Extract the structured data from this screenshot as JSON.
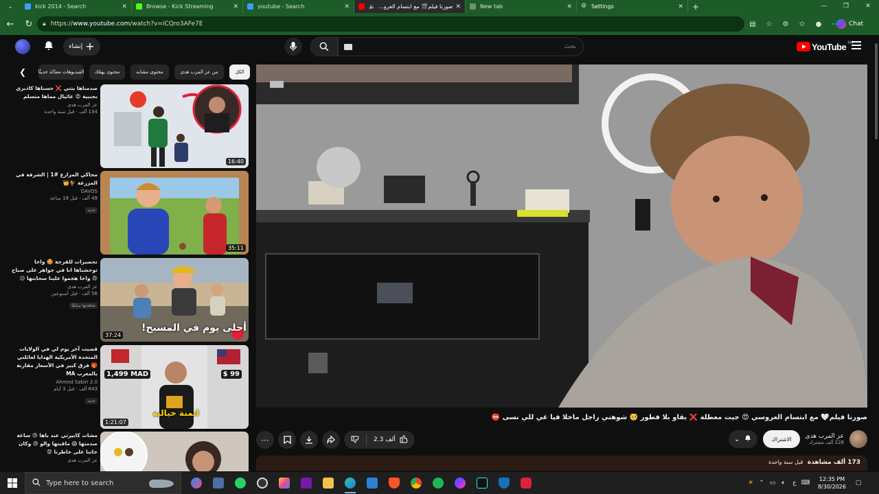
{
  "browser": {
    "tabs": [
      {
        "title": "kick 2014 - Search",
        "color": "#3aa0ff",
        "active": false
      },
      {
        "title": "Browse - Kick Streaming",
        "color": "#53fc18",
        "active": false
      },
      {
        "title": "youtube - Search",
        "color": "#3aa0ff",
        "active": false
      },
      {
        "title": "صورنا فيلم🎬 مع ابتسام العرو...",
        "color": "#ff0000",
        "active": true
      },
      {
        "title": "New tab",
        "color": "#6e8f78",
        "active": false
      },
      {
        "title": "Settings",
        "color": "#cfcfcf",
        "active": false
      }
    ],
    "url_prefix": "https://",
    "url_host": "www.youtube.com",
    "url_path": "/watch?v=iCQro3AFe7E",
    "chat_label": "Chat"
  },
  "youtube": {
    "create_label": "إنشاء",
    "search_placeholder": "بحث",
    "logo_text": "YouTube",
    "logo_country": "MA",
    "chips": [
      {
        "label": "الكل",
        "active": true
      },
      {
        "label": "من عز المرب هدى",
        "active": false
      },
      {
        "label": "محتوى مشابه",
        "active": false
      },
      {
        "label": "محتوى يهمّك",
        "active": false
      },
      {
        "label": "الفيديوهات معدّلة حديثًا",
        "active": false
      }
    ],
    "suggestions": [
      {
        "title": "صدمناها بتتي ❌ حسناها كاذبري بجنبية 😡 عائيال مماها متسلم",
        "channel": "عز المرب هدى",
        "meta": "134 ألف · قبل سنة واحدة",
        "badge": "",
        "duration": "16:40"
      },
      {
        "title": "محاكي المزارع #1 | الشرفة في المزرعة 🐓👑",
        "channel": "DAVOS",
        "meta": "49 ألف · قبل 19 ساعة",
        "badge": "جديد",
        "duration": "35:11"
      },
      {
        "title": "تحضيرات للفرجة 🤩 واخا توحشناها انا في جواهر على صباح 😡 واخا هجموا علينا سحابتها 😕",
        "channel": "عز المرب هدى",
        "meta": "56 ألف · قبل أسبوعين",
        "badge": "شاهدتها سابقًا",
        "duration": "37:24",
        "overlay": "أحلى يوم في المسبح!"
      },
      {
        "title": "قضيت آخر يوم لي في الولايات المتحدة الأمريكية الهدايا لعائلتي 🎁 فرق كبير في الأسعار مقارنة بالمغرب MA",
        "channel": "Ahmed Sabiri 2.0",
        "meta": "643 ألف · قبل 3 أيام",
        "badge": "جديد",
        "duration": "1:21:07",
        "price_left": "1,499 MAD",
        "price_right": "$ 99",
        "overlay": "اتمنة خيالية"
      },
      {
        "title": "مشات كابيرتي عند باها 😢 ساعة صدمتها 😱 ماقبتها والو 😢 وكان خاتنا على خاطرنا 😟",
        "channel": "عز المرب هدى",
        "meta": "",
        "badge": "",
        "duration": ""
      }
    ],
    "video": {
      "title": "صورنا فيلم🤍 مع ابتسام العروسي 😍 جيت معطلة ❌ بقاو بلا فطور 🥺 شوهني راجل ماخلا فيا غي للي نسى ⛔",
      "likes": "2.3 ألف",
      "subscribe_label": "الاشتراك",
      "channel_name": "عز المرب هدى",
      "subscribers": "228 ألف مشترك",
      "views": "173 ألف مشاهدة",
      "published": "قبل سنة واحدة"
    }
  },
  "taskbar": {
    "search_placeholder": "Type here to search",
    "time": "12:35 PM",
    "date": "8/30/2026"
  }
}
